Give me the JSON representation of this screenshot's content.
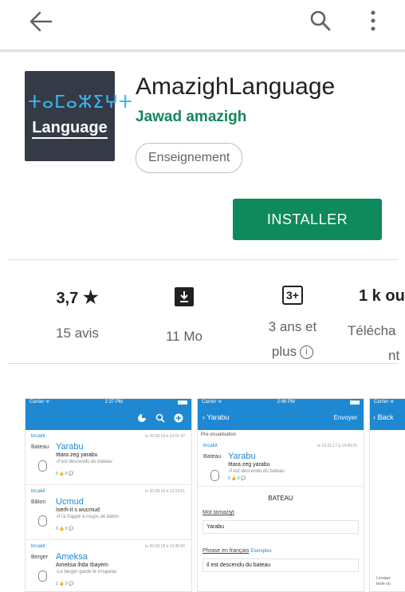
{
  "topbar": {
    "back_icon": "arrow-left-icon",
    "search_icon": "magnifier-icon",
    "more_icon": "vertical-dots-icon"
  },
  "app": {
    "icon_tifinagh": "ⵜⴰⵎⴰⵣⵉⵖⵜ",
    "icon_word": "Language",
    "title": "AmazighLanguage",
    "developer": "Jawad amazigh",
    "category": "Enseignement",
    "install_label": "INSTALLER"
  },
  "stats": {
    "rating": {
      "value": "3,7",
      "star": "★",
      "label": "15 avis"
    },
    "size": {
      "value_icon": "download-icon",
      "label": "11 Mo"
    },
    "age": {
      "value": "3+",
      "label_line1": "3 ans et",
      "label_line2": "plus"
    },
    "downloads": {
      "value": "1 k ou",
      "label_line1": "Télécha",
      "label_line2": "nt"
    }
  },
  "shot1": {
    "status_left": "Carrier ᯤ",
    "status_time": "2:37 PM",
    "items": [
      {
        "user": "brcakit",
        "date": "le 20.08.18 à 23:01:47",
        "fr": "Bateau",
        "kab": "Yarabu",
        "sent": "Ittara zeg yarabu",
        "tr": "-Il est descendu du bateau",
        "votes": "0 👍  0 💬"
      },
      {
        "user": "brcakit",
        "date": "le 20.08.18 à 12:19:51",
        "fr": "Bâton",
        "kab": "Ucmud",
        "sent": "Iserh-it s wucmud",
        "tr": "-Il l'a frappé à coups de bâton",
        "votes": "0 👍  0 💬"
      },
      {
        "user": "brcakit",
        "date": "le 20.08.18 à 12:49:56",
        "fr": "Berger",
        "kab": "Ameksa",
        "sent": "Ameksa ihda rbayem",
        "tr": "-Le berger garde le troupeau",
        "votes": "1 👍  0 💬"
      }
    ]
  },
  "shot2": {
    "status_left": "Carrier ᯤ",
    "status_time": "2:46 PM",
    "back": "‹ Yarabu",
    "send": "Envoyer",
    "preview": "Pre-visualisation",
    "user": "brcakit",
    "date": "le 15.01.17 à 14:49:01",
    "fr": "Bateau",
    "kab": "Yarabu",
    "sent": "Ittara zeg yarabu",
    "tr": "-Il est descendu du bateau",
    "votes": "0 👍  0 💬",
    "heading": "BATEAU",
    "field1_label": "Mot tamaziɣt",
    "field1_value": "Yarabu",
    "field2_label": "Phrase en français",
    "field2_link": "Exemples",
    "field2_value": "Il est descendu du bateau"
  },
  "shot3": {
    "status_left": "Carrier ᯤ",
    "back": "‹ Back",
    "bottom_text": "Lorsque",
    "bottom_text2": "texte où"
  }
}
